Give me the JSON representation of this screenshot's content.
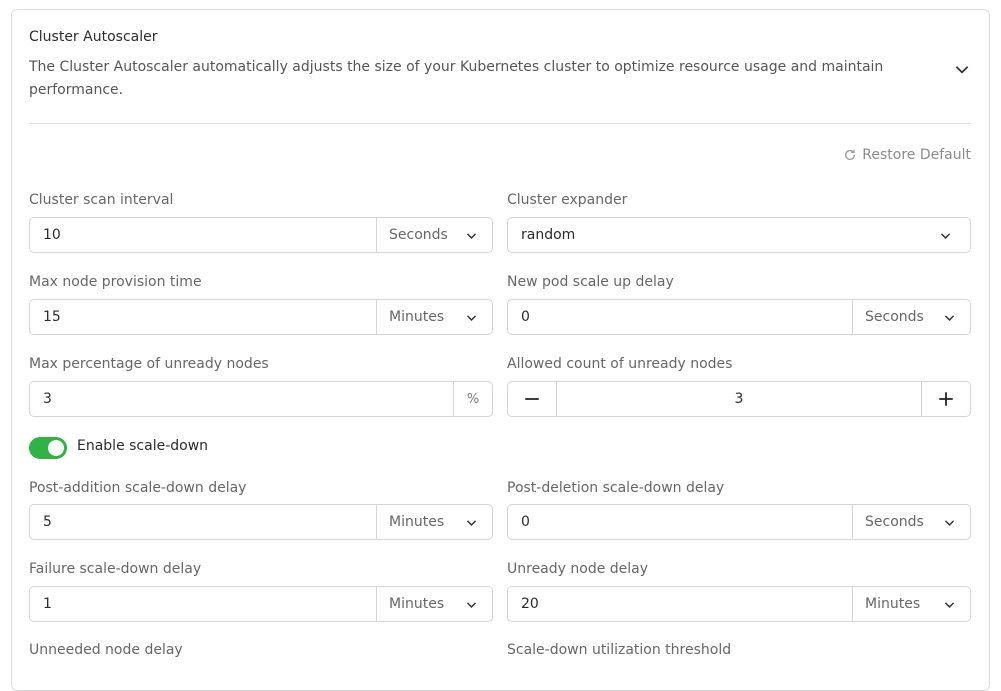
{
  "section": {
    "title": "Cluster Autoscaler",
    "description": "The Cluster Autoscaler automatically adjusts the size of your Kubernetes cluster to optimize resource usage and maintain performance.",
    "restore_label": "Restore Default"
  },
  "fields": {
    "scan_interval": {
      "label": "Cluster scan interval",
      "value": "10",
      "unit": "Seconds"
    },
    "expander": {
      "label": "Cluster expander",
      "value": "random"
    },
    "provision_time": {
      "label": "Max node provision time",
      "value": "15",
      "unit": "Minutes"
    },
    "scale_up_delay": {
      "label": "New pod scale up delay",
      "value": "0",
      "unit": "Seconds"
    },
    "max_unready_pct": {
      "label": "Max percentage of unready nodes",
      "value": "3",
      "unit": "%"
    },
    "unready_count": {
      "label": "Allowed count of unready nodes",
      "value": "3"
    },
    "scale_down": {
      "label": "Enable scale-down",
      "enabled": true
    },
    "post_add_delay": {
      "label": "Post-addition scale-down delay",
      "value": "5",
      "unit": "Minutes"
    },
    "post_del_delay": {
      "label": "Post-deletion scale-down delay",
      "value": "0",
      "unit": "Seconds"
    },
    "failure_delay": {
      "label": "Failure scale-down delay",
      "value": "1",
      "unit": "Minutes"
    },
    "unready_delay": {
      "label": "Unready node delay",
      "value": "20",
      "unit": "Minutes"
    },
    "unneeded_delay": {
      "label": "Unneeded node delay"
    },
    "util_threshold": {
      "label": "Scale-down utilization threshold"
    }
  },
  "colors": {
    "toggle_on": "#2fb344",
    "border": "#d4d4d4",
    "muted_text": "#666666"
  }
}
